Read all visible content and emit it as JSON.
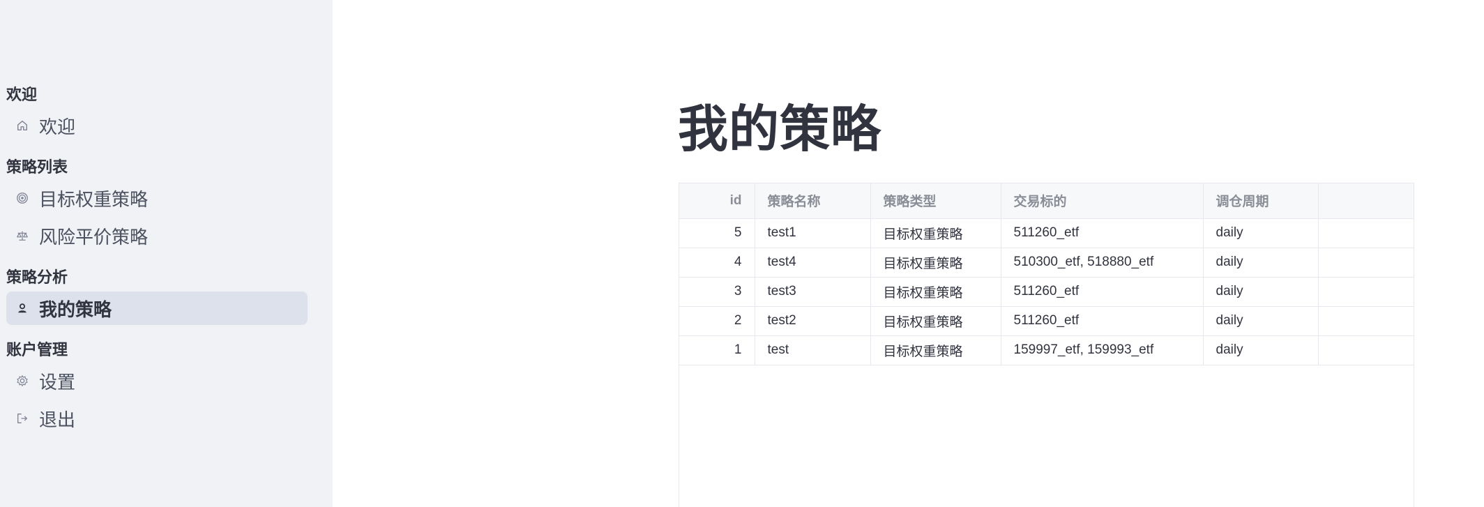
{
  "sidebar": {
    "sections": [
      {
        "title": "欢迎",
        "items": [
          {
            "label": "欢迎",
            "icon": "home-icon"
          }
        ]
      },
      {
        "title": "策略列表",
        "items": [
          {
            "label": "目标权重策略",
            "icon": "target-icon"
          },
          {
            "label": "风险平价策略",
            "icon": "scale-icon"
          }
        ]
      },
      {
        "title": "策略分析",
        "items": [
          {
            "label": "我的策略",
            "icon": "person-icon",
            "active": true
          }
        ]
      },
      {
        "title": "账户管理",
        "items": [
          {
            "label": "设置",
            "icon": "gear-icon"
          },
          {
            "label": "退出",
            "icon": "logout-icon"
          }
        ]
      }
    ]
  },
  "main": {
    "title": "我的策略",
    "table": {
      "columns": [
        "id",
        "策略名称",
        "策略类型",
        "交易标的",
        "调仓周期",
        ""
      ],
      "rows": [
        [
          "5",
          "test1",
          "目标权重策略",
          "511260_etf",
          "daily",
          ""
        ],
        [
          "4",
          "test4",
          "目标权重策略",
          "510300_etf, 518880_etf",
          "daily",
          ""
        ],
        [
          "3",
          "test3",
          "目标权重策略",
          "511260_etf",
          "daily",
          ""
        ],
        [
          "2",
          "test2",
          "目标权重策略",
          "511260_etf",
          "daily",
          ""
        ],
        [
          "1",
          "test",
          "目标权重策略",
          "159997_etf, 159993_etf",
          "daily",
          ""
        ]
      ]
    }
  },
  "colors": {
    "sidebar_bg": "#f0f2f6",
    "active_item_bg": "#dde1eb",
    "text": "#31333f",
    "header_text": "#8a8d96"
  }
}
